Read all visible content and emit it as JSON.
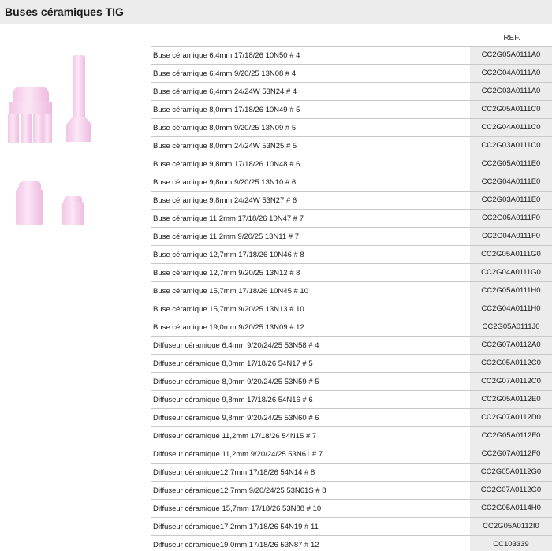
{
  "page": {
    "title": "Buses céramiques TIG"
  },
  "table": {
    "ref_header": "REF.",
    "rows": [
      {
        "description": "Buse céramique 6,4mm 17/18/26 10N50 # 4",
        "ref": "CC2G05A0111A0"
      },
      {
        "description": "Buse céramique 6,4mm 9/20/25 13N08 # 4",
        "ref": "CC2G04A0111A0"
      },
      {
        "description": "Buse céramique 6,4mm 24/24W 53N24 # 4",
        "ref": "CC2G03A0111A0"
      },
      {
        "description": "Buse céramique 8,0mm 17/18/26 10N49 # 5",
        "ref": "CC2G05A0111C0"
      },
      {
        "description": "Buse céramique 8,0mm 9/20/25 13N09 # 5",
        "ref": "CC2G04A0111C0"
      },
      {
        "description": "Buse céramique 8,0mm 24/24W 53N25 # 5",
        "ref": "CC2G03A0111C0"
      },
      {
        "description": "Buse céramique 9,8mm 17/18/26 10N48 # 6",
        "ref": "CC2G05A0111E0"
      },
      {
        "description": "Buse céramique 9,8mm 9/20/25 13N10 # 6",
        "ref": "CC2G04A0111E0"
      },
      {
        "description": "Buse céramique 9,8mm 24/24W 53N27 # 6",
        "ref": "CC2G03A0111E0"
      },
      {
        "description": "Buse céramique 11,2mm 17/18/26 10N47 # 7",
        "ref": "CC2G05A0111F0"
      },
      {
        "description": "Buse céramique 11,2mm 9/20/25 13N11 # 7",
        "ref": "CC2G04A0111F0"
      },
      {
        "description": "Buse céramique 12,7mm 17/18/26 10N46 # 8",
        "ref": "CC2G05A0111G0"
      },
      {
        "description": "Buse céramique 12,7mm 9/20/25 13N12 # 8",
        "ref": "CC2G04A0111G0"
      },
      {
        "description": "Buse céramique 15,7mm 17/18/26 10N45 # 10",
        "ref": "CC2G05A0111H0"
      },
      {
        "description": "Buse céramique 15,7mm 9/20/25 13N13 # 10",
        "ref": "CC2G04A0111H0"
      },
      {
        "description": "Buse céramique 19,0mm 9/20/25 13N09 # 12",
        "ref": "CC2G05A0111J0"
      },
      {
        "description": "Diffuseur céramique 6,4mm 9/20/24/25 53N58 # 4",
        "ref": "CC2G07A0112A0"
      },
      {
        "description": "Diffuseur céramique 8,0mm 17/18/26 54N17 # 5",
        "ref": "CC2G05A0112C0"
      },
      {
        "description": "Diffuseur céramique 8,0mm 9/20/24/25 53N59 # 5",
        "ref": "CC2G07A0112C0"
      },
      {
        "description": "Diffuseur céramique 9,8mm 17/18/26 54N16 # 6",
        "ref": "CC2G05A0112E0"
      },
      {
        "description": "Diffuseur céramique 9,8mm 9/20/24/25 53N60 # 6",
        "ref": "CC2G07A0112D0"
      },
      {
        "description": "Diffuseur céramique 11,2mm 17/18/26 54N15 # 7",
        "ref": "CC2G05A0112F0"
      },
      {
        "description": "Diffuseur céramique 11,2mm 9/20/24/25 53N61 # 7",
        "ref": "CC2G07A0112F0"
      },
      {
        "description": "Diffuseur céramique12,7mm 17/18/26 54N14 # 8",
        "ref": "CC2G05A0112G0"
      },
      {
        "description": "Diffuseur céramique12,7mm 9/20/24/25 53N61S # 8",
        "ref": "CC2G07A0112G0"
      },
      {
        "description": "Diffuseur céramique 15,7mm 17/18/26 53N88 # 10",
        "ref": "CC2G05A0114H0"
      },
      {
        "description": "Diffuseur céramique17,2mm 17/18/26 54N19 # 11",
        "ref": "CC2G05A0112I0"
      },
      {
        "description": "Diffuseur céramique19,0mm 17/18/26 53N87 # 12",
        "ref": "CC103339"
      }
    ]
  },
  "colors": {
    "header_bg": "#ececec",
    "ref_cell_bg": "#ececec",
    "ceramic_pink": "#f6d4ec",
    "row_border": "#c8c8c8"
  },
  "icons": [
    "ceramic-nozzle-wide-icon",
    "ceramic-nozzle-long-icon",
    "ceramic-nozzle-small-icon",
    "ceramic-nozzle-tiny-icon"
  ]
}
